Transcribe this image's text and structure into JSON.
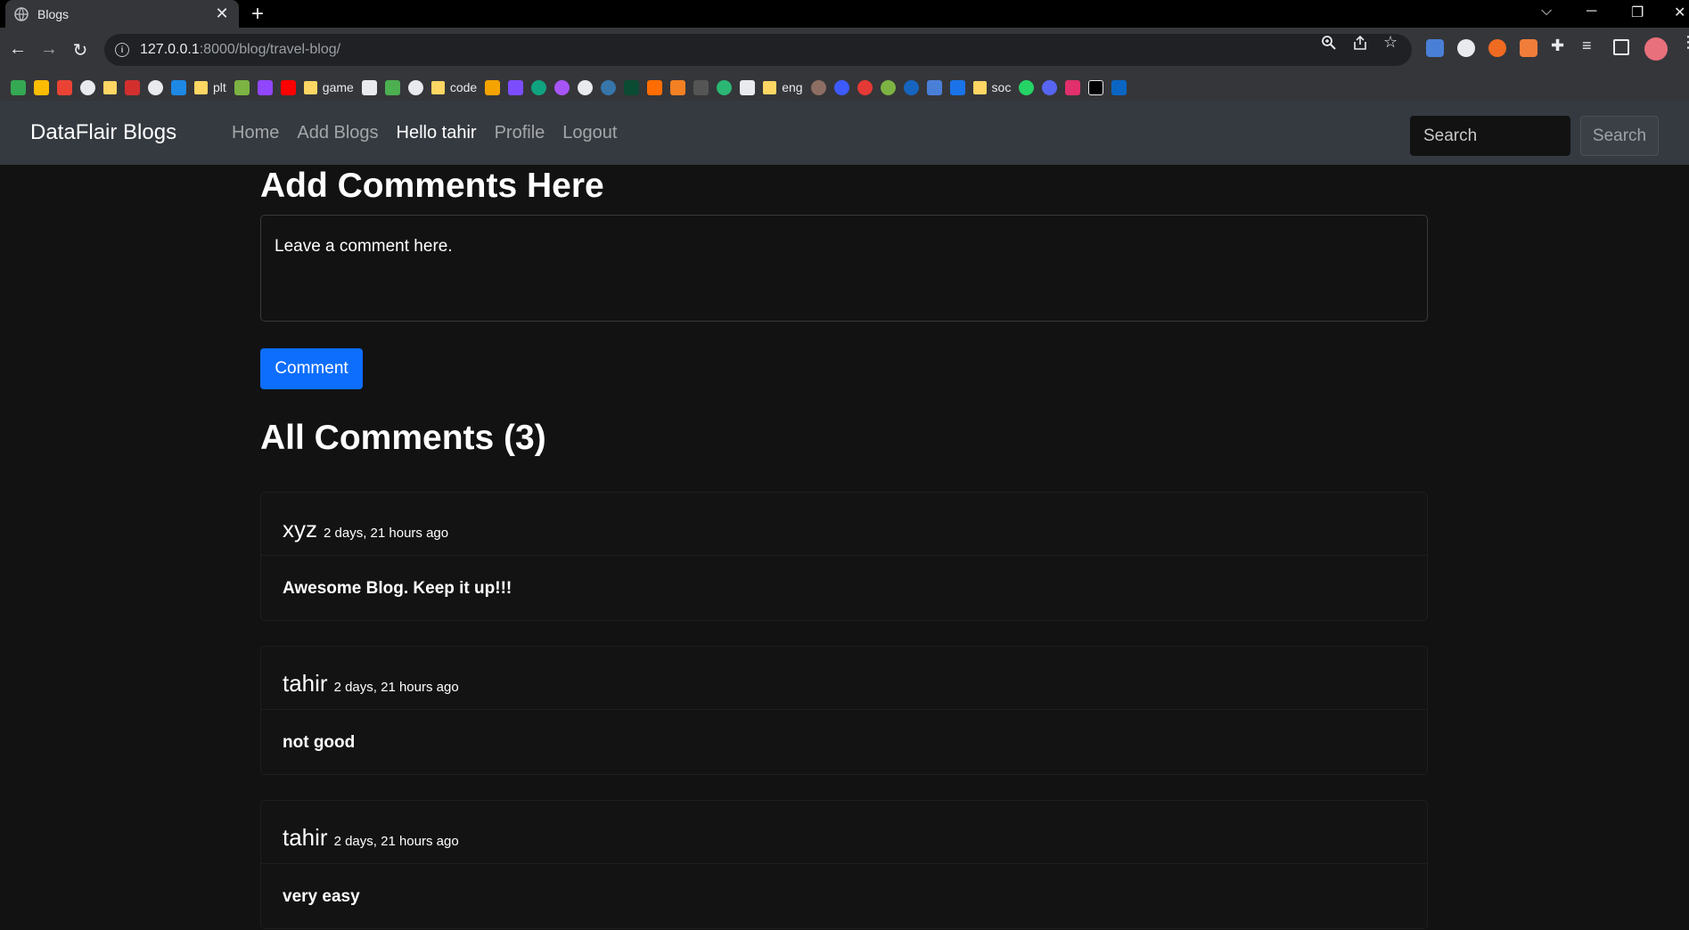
{
  "browser": {
    "tab_title": "Blogs",
    "tab_close": "✕",
    "new_tab": "+",
    "url_host": "127.0.0.1",
    "url_path": ":8000/blog/travel-blog/",
    "bookmarks": [
      "plt",
      "game",
      "code",
      "eng",
      "soc"
    ]
  },
  "navbar": {
    "brand": "DataFlair Blogs",
    "links": [
      {
        "label": "Home",
        "active": false
      },
      {
        "label": "Add Blogs",
        "active": false
      },
      {
        "label": "Hello tahir",
        "active": true
      },
      {
        "label": "Profile",
        "active": false
      },
      {
        "label": "Logout",
        "active": false
      }
    ],
    "search_placeholder": "Search",
    "search_button": "Search"
  },
  "comment_form": {
    "heading": "Add Comments Here",
    "placeholder": "Leave a comment here.",
    "button": "Comment"
  },
  "comments_section": {
    "heading": "All Comments (3)",
    "comments": [
      {
        "author": "xyz",
        "time": "2 days, 21 hours ago",
        "text": "Awesome Blog. Keep it up!!!"
      },
      {
        "author": "tahir",
        "time": "2 days, 21 hours ago",
        "text": "not good"
      },
      {
        "author": "tahir",
        "time": "2 days, 21 hours ago",
        "text": "very easy"
      }
    ]
  },
  "colors": {
    "page_bg": "#121212",
    "navbar_bg": "#343a40",
    "primary": "#0d6efd"
  }
}
